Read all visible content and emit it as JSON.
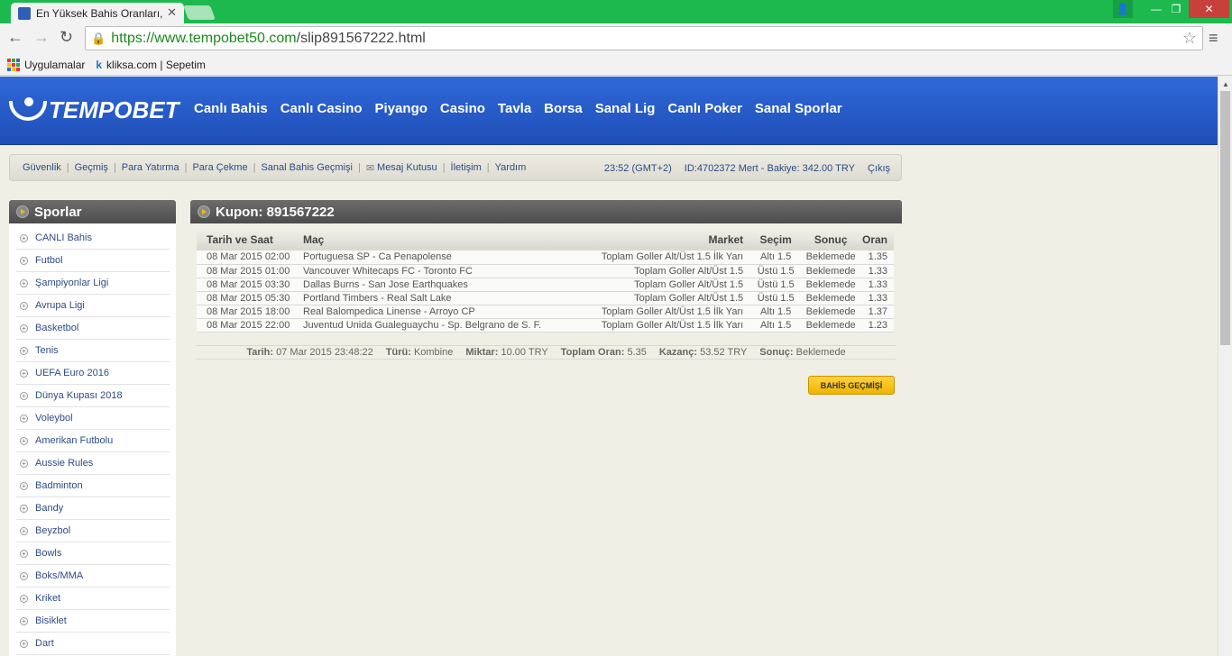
{
  "browser": {
    "tab_title": "En Yüksek Bahis Oranları, Y",
    "tab_close": "✕",
    "url_secure": "https://www.tempobet50.com",
    "url_path": "/slip891567222.html",
    "bookmarks": [
      "Uygulamalar",
      "kliksa.com | Sepetim"
    ]
  },
  "site": {
    "logo_text": "TEMPOBET",
    "nav": [
      "Canlı Bahis",
      "Canlı Casino",
      "Piyango",
      "Casino",
      "Tavla",
      "Borsa",
      "Sanal Lig",
      "Canlı Poker",
      "Sanal Sporlar"
    ]
  },
  "subbar": {
    "links": [
      "Güvenlik",
      "Geçmiş",
      "Para Yatırma",
      "Para Çekme",
      "Sanal Bahis Geçmişi",
      "Mesaj Kutusu",
      "İletişim",
      "Yardım"
    ],
    "time": "23:52 (GMT+2)",
    "account": "ID:4702372 Mert - Bakiye: 342.00 TRY",
    "logout": "Çıkış"
  },
  "sidebar": {
    "title": "Sporlar",
    "items": [
      "CANLI Bahis",
      "Futbol",
      "Şampiyonlar Ligi",
      "Avrupa Ligi",
      "Basketbol",
      "Tenis",
      "UEFA Euro 2016",
      "Dünya Kupası 2018",
      "Voleybol",
      "Amerikan Futbolu",
      "Aussie Rules",
      "Badminton",
      "Bandy",
      "Beyzbol",
      "Bowls",
      "Boks/MMA",
      "Kriket",
      "Bisiklet",
      "Dart"
    ]
  },
  "coupon": {
    "title": "Kupon: 891567222",
    "columns": [
      "Tarih ve Saat",
      "Maç",
      "Market",
      "Seçim",
      "Sonuç",
      "Oran"
    ],
    "rows": [
      [
        "08 Mar 2015 02:00",
        "Portuguesa SP - Ca Penapolense",
        "Toplam Goller Alt/Üst 1.5 İlk Yarı",
        "Altı 1.5",
        "Beklemede",
        "1.35"
      ],
      [
        "08 Mar 2015 01:00",
        "Vancouver Whitecaps FC - Toronto FC",
        "Toplam Goller Alt/Üst 1.5",
        "Üstü 1.5",
        "Beklemede",
        "1.33"
      ],
      [
        "08 Mar 2015 03:30",
        "Dallas Burns - San Jose Earthquakes",
        "Toplam Goller Alt/Üst 1.5",
        "Üstü 1.5",
        "Beklemede",
        "1.33"
      ],
      [
        "08 Mar 2015 05:30",
        "Portland Timbers - Real Salt Lake",
        "Toplam Goller Alt/Üst 1.5",
        "Üstü 1.5",
        "Beklemede",
        "1.33"
      ],
      [
        "08 Mar 2015 18:00",
        "Real Balompedica Linense - Arroyo CP",
        "Toplam Goller Alt/Üst 1.5 İlk Yarı",
        "Altı 1.5",
        "Beklemede",
        "1.37"
      ],
      [
        "08 Mar 2015 22:00",
        "Juventud Unida Gualeguaychu - Sp. Belgrano de S. F.",
        "Toplam Goller Alt/Üst 1.5 İlk Yarı",
        "Altı 1.5",
        "Beklemede",
        "1.23"
      ]
    ],
    "summary": {
      "date_label": "Tarih:",
      "date": "07 Mar 2015 23:48:22",
      "type_label": "Türü:",
      "type": "Kombine",
      "amount_label": "Miktar:",
      "amount": "10.00 TRY",
      "total_odds_label": "Toplam Oran:",
      "total_odds": "5.35",
      "win_label": "Kazanç:",
      "win": "53.52 TRY",
      "result_label": "Sonuç:",
      "result": "Beklemede"
    },
    "history_button": "BAHİS GEÇMİŞİ"
  }
}
